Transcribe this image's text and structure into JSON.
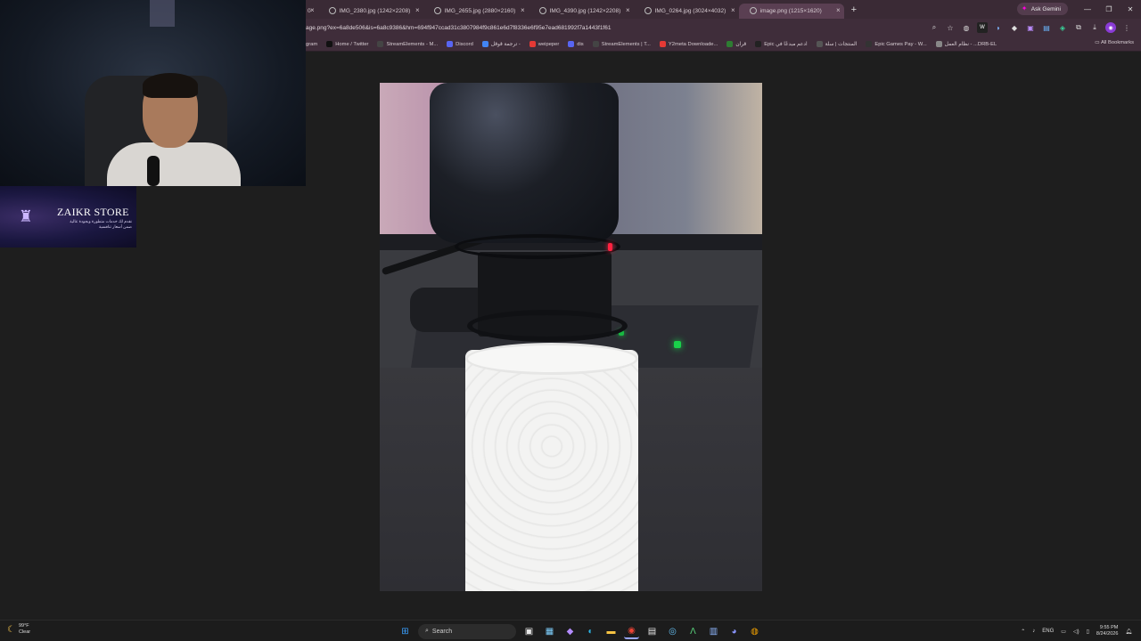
{
  "tabs": [
    {
      "label": "0"
    },
    {
      "label": "IMG_2380.jpg (1242×2208)"
    },
    {
      "label": "IMG_2655.jpg (2880×2160)"
    },
    {
      "label": "IMG_4390.jpg (1242×2208)"
    },
    {
      "label": "IMG_0264.jpg (3024×4032)"
    },
    {
      "label": "image.png (1215×1620)"
    }
  ],
  "browser": {
    "new_tab": "+",
    "ask_gemini": "Ask Gemini",
    "url": "age.png?ex=6a8de506&is=6a8c9386&hm=694f947ccad31c3807984f9c861e6d7f8336e6f95e7ead681992f7a1443f1f61",
    "all_bookmarks": "All Bookmarks",
    "close_glyph": "×",
    "minimize_glyph": "—",
    "restore_glyph": "❐",
    "close_window_glyph": "✕"
  },
  "bookmarks": [
    {
      "label": "gram",
      "color": "#c13584"
    },
    {
      "label": "Home / Twitter",
      "color": "#111111"
    },
    {
      "label": "StreamElements - M...",
      "color": "#444444"
    },
    {
      "label": "Discord",
      "color": "#5865f2"
    },
    {
      "label": "ترجمة قوقل -",
      "color": "#4285f4"
    },
    {
      "label": "weipeper",
      "color": "#e53935"
    },
    {
      "label": "dis",
      "color": "#5865f2"
    },
    {
      "label": "StreamElements | T...",
      "color": "#444444"
    },
    {
      "label": "Y2meta Downloade...",
      "color": "#e53935"
    },
    {
      "label": "قران",
      "color": "#2e7d32"
    },
    {
      "label": "Epic ادعم مبدعًا في",
      "color": "#222222"
    },
    {
      "label": "المنتجات | سلة",
      "color": "#555555"
    },
    {
      "label": "Epic Games Pay - W...",
      "color": "#333333"
    },
    {
      "label": "نظام العمل - ...DRB-EL",
      "color": "#888888"
    }
  ],
  "overlay": {
    "store_name": "ZAIKR STORE",
    "store_tagline": "نقدم لك خدمات متطورة وبجودة عالية ضمن أسعار تنافسية"
  },
  "taskbar": {
    "temperature": "99°F",
    "condition": "Clear",
    "search_label": "Search",
    "language": "ENG",
    "time": "9:55 PM",
    "date": "8/24/2026"
  },
  "icons": {
    "start": "start-icon",
    "search": "search-icon",
    "browser": "chrome-icon",
    "discord": "discord-icon"
  }
}
